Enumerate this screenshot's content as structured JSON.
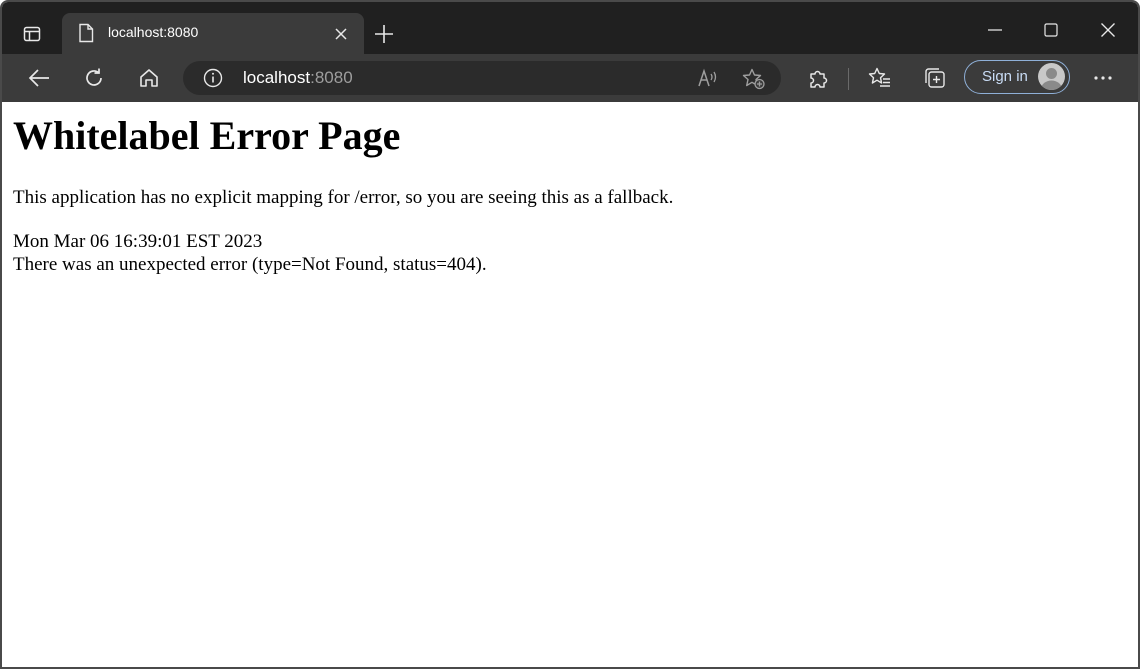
{
  "browser": {
    "tab": {
      "title": "localhost:8080"
    },
    "address": {
      "host": "localhost",
      "port": ":8080"
    },
    "toolbar": {
      "sign_in_label": "Sign in"
    },
    "icons": {
      "tab_actions": "tab-actions-icon",
      "favicon": "page-icon",
      "tab_close": "close-icon",
      "new_tab": "plus-icon",
      "minimize": "minimize-icon",
      "maximize": "maximize-icon",
      "close_window": "close-icon",
      "back": "back-arrow-icon",
      "refresh": "refresh-icon",
      "home": "home-icon",
      "site_info": "info-icon",
      "read_aloud": "read-aloud-icon",
      "add_favorite": "add-favorite-icon",
      "extensions": "puzzle-icon",
      "favorites": "favorites-icon",
      "collections": "collections-icon",
      "profile": "avatar-icon",
      "more": "more-icon"
    },
    "colors": {
      "tabstrip": "#202020",
      "toolbar": "#3b3b3b",
      "address_bar": "#2b2b2b",
      "sign_in_border": "#8fb0d8"
    }
  },
  "page": {
    "title": "Whitelabel Error Page",
    "message": "This application has no explicit mapping for /error, so you are seeing this as a fallback.",
    "timestamp": "Mon Mar 06 16:39:01 EST 2023",
    "error": "There was an unexpected error (type=Not Found, status=404)."
  }
}
